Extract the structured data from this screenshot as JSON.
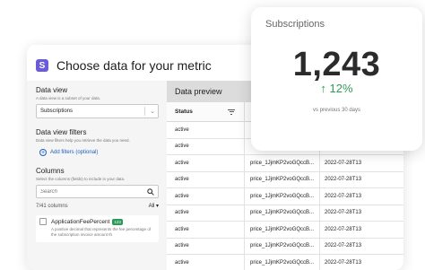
{
  "header": {
    "logo_letter": "S",
    "title": "Choose data for your metric"
  },
  "data_view": {
    "title": "Data view",
    "subtitle": "A data view is a subset of your data.",
    "selected": "Subscriptions",
    "chevron": "⌄"
  },
  "filters": {
    "title": "Data view filters",
    "subtitle": "Data view filters help you retrieve the data you need.",
    "add_label": "Add filters (optional)",
    "plus": "+"
  },
  "columns": {
    "title": "Columns",
    "subtitle": "Select the columns (fields) to include in your data.",
    "search_placeholder": "Search",
    "count_label": "7/41 columns",
    "all_select": "All",
    "all_chevron": "▾",
    "item": {
      "name": "ApplicationFeePercent",
      "badge": "123",
      "description": "A positive decimal that represents the fee percentage of the subscription invoice amount th"
    }
  },
  "preview": {
    "title": "Data preview",
    "status_header": "Status",
    "rows": [
      {
        "status": "active",
        "price": "",
        "date": ""
      },
      {
        "status": "active",
        "price": "",
        "date": ""
      },
      {
        "status": "active",
        "price": "price_1JjmKP2voGQccB...",
        "date": "2022-07-28T13"
      },
      {
        "status": "active",
        "price": "price_1JjmKP2voGQccB...",
        "date": "2022-07-28T13"
      },
      {
        "status": "active",
        "price": "price_1JjmKP2voGQccB...",
        "date": "2022-07-28T13"
      },
      {
        "status": "active",
        "price": "price_1JjmKP2voGQccB...",
        "date": "2022-07-28T13"
      },
      {
        "status": "active",
        "price": "price_1JjmKP2voGQccB...",
        "date": "2022-07-28T13"
      },
      {
        "status": "active",
        "price": "price_1JjmKP2voGQccB...",
        "date": "2022-07-28T13"
      },
      {
        "status": "active",
        "price": "price_1JjmKP2voGQccB...",
        "date": "2022-07-28T13"
      }
    ]
  },
  "metric_card": {
    "title": "Subscriptions",
    "value": "1,243",
    "delta": "↑ 12%",
    "note": "vs previous 30 days",
    "delta_color": "#2f9a55"
  },
  "icons": {
    "logo": "logo-icon",
    "plus": "plus-circle-icon",
    "search": "search-icon",
    "filter": "filter-icon",
    "chevron": "chevron-down-icon",
    "checkbox": "checkbox-icon"
  }
}
